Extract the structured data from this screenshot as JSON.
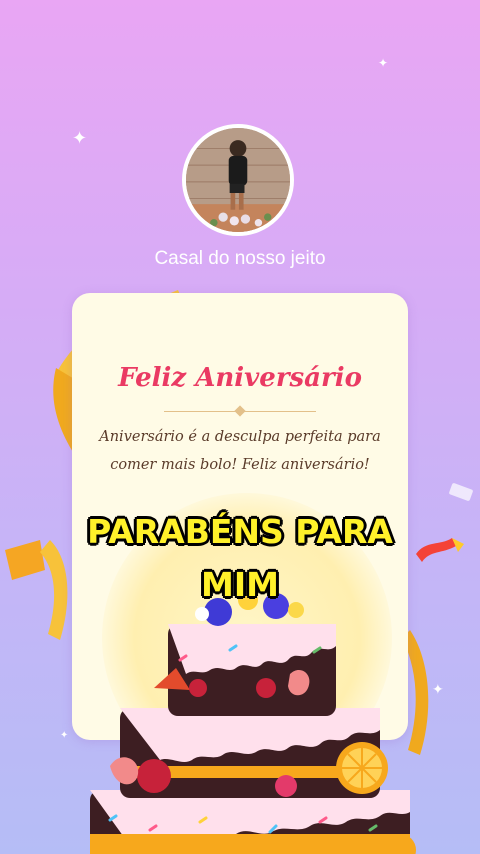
{
  "profile": {
    "name": "Casal do nosso jeito"
  },
  "card": {
    "title": "Feliz Aniversário",
    "message_line1": "Aniversário é a desculpa perfeita para",
    "message_line2": "comer mais bolo! Feliz aniversário!"
  },
  "caption": {
    "line1": "PARABÉNS PARA",
    "line2": "MIM"
  },
  "colors": {
    "title": "#ea3a63",
    "caption": "#fff12a",
    "card_bg": "#fffbe6"
  }
}
